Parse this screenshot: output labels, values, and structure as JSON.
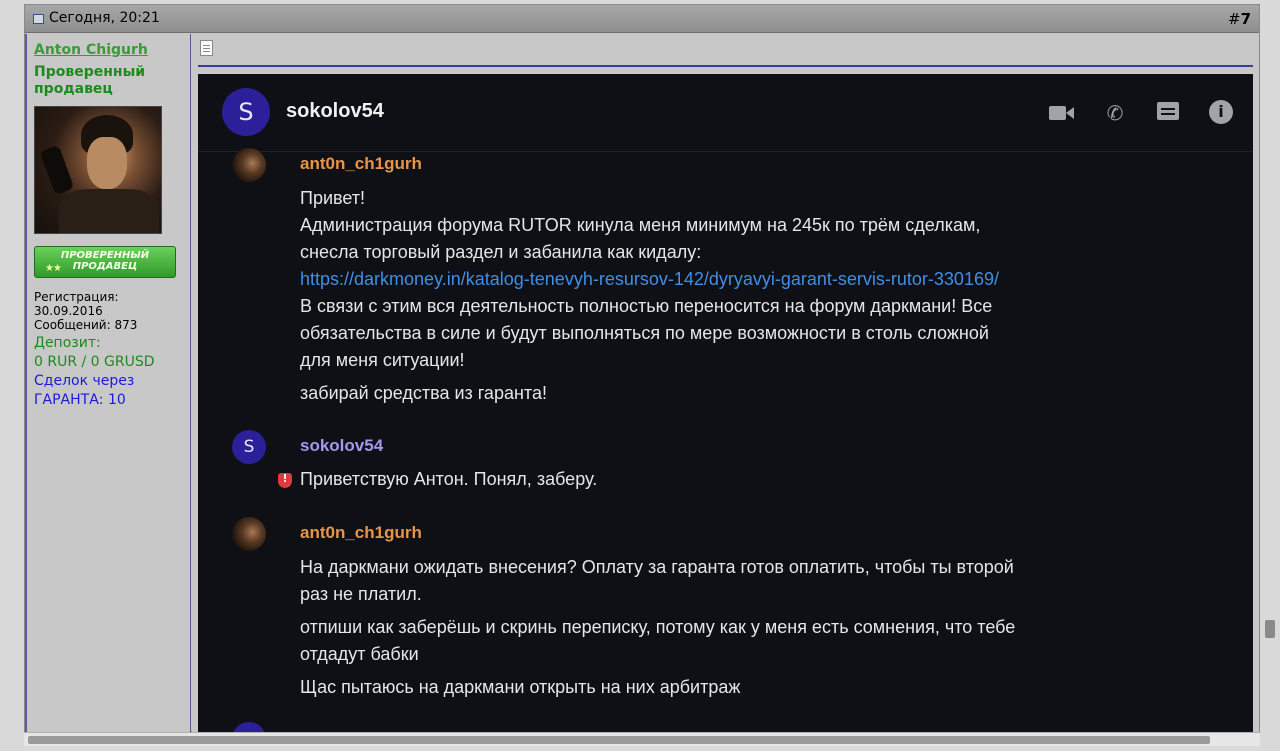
{
  "post": {
    "date": "Сегодня, 20:21",
    "number_prefix": "#",
    "number": "7"
  },
  "user": {
    "name": "Anton Chigurh",
    "title": "Проверенный продавец",
    "badge_label": "ПРОВЕРЕННЫЙ ПРОДАВЕЦ",
    "badge_stars": "★★",
    "registration_label": "Регистрация:",
    "registration_date": "30.09.2016",
    "posts_label": "Сообщений: 873",
    "deposit_label": "Депозит:",
    "deposit_value": "0 RUR / 0 GRUSD",
    "deals_line1": "Сделок через",
    "deals_line2": "ГАРАНТА: 10"
  },
  "chat": {
    "header_avatar": "S",
    "header_name": "sokolov54",
    "messages": [
      {
        "author": "ant0n_ch1gurh",
        "lines": [
          "Привет!",
          "Администрация форума RUTOR кинула меня минимум на 245к по трём сделкам,",
          "снесла торговый раздел и забанила как кидалу:"
        ],
        "link": "https://darkmoney.in/katalog-tenevyh-resursov-142/dyryavyi-garant-servis-rutor-330169/",
        "lines2": [
          "В связи с этим вся деятельность полностью переносится на форум даркмани! Все",
          "обязательства в силе и будут выполняться по мере возможности в столь сложной",
          "для меня ситуации!"
        ],
        "extra": "забирай средства из гаранта!"
      },
      {
        "avatar": "S",
        "author": "sokolov54",
        "text": "Приветствую Антон. Понял, заберу."
      },
      {
        "author": "ant0n_ch1gurh",
        "p1_l1": "На даркмани ожидать внесения? Оплату за гаранта готов оплатить, чтобы ты второй",
        "p1_l2": "раз не платил.",
        "p2_l1": "отпиши как заберёшь и скринь переписку, потому как у меня есть сомнения, что тебе",
        "p2_l2": "отдадут бабки",
        "p3": "Щас пытаюсь на даркмани открыть на них арбитраж"
      }
    ]
  },
  "icons": {
    "video": "video-camera-icon",
    "phone": "phone-icon",
    "chat": "chat-icon",
    "info": "info-icon",
    "info_glyph": "i",
    "phone_glyph": "✆"
  }
}
